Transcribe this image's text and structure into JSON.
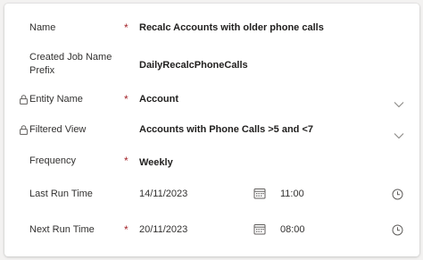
{
  "form": {
    "name": {
      "label": "Name",
      "required": "*",
      "value": "Recalc Accounts with older phone calls"
    },
    "prefix": {
      "label": "Created Job Name Prefix",
      "value": "DailyRecalcPhoneCalls"
    },
    "entity": {
      "label": "Entity Name",
      "required": "*",
      "value": "Account",
      "locked_icon": "lock-icon",
      "dropdown_icon": "chevron-down-icon"
    },
    "view": {
      "label": "Filtered View",
      "value": "Accounts with Phone Calls >5 and <7",
      "locked_icon": "lock-icon",
      "dropdown_icon": "chevron-down-icon"
    },
    "frequency": {
      "label": "Frequency",
      "required": "*",
      "value": "Weekly"
    },
    "last_run": {
      "label": "Last Run Time",
      "date": "14/11/2023",
      "time": "11:00",
      "date_icon": "calendar-icon",
      "time_icon": "clock-icon"
    },
    "next_run": {
      "label": "Next Run Time",
      "required": "*",
      "date": "20/11/2023",
      "time": "08:00",
      "date_icon": "calendar-icon",
      "time_icon": "clock-icon"
    }
  },
  "colors": {
    "required": "#a4262c",
    "text": "#323130",
    "value": "#201f1e",
    "icon": "#605e5c"
  }
}
